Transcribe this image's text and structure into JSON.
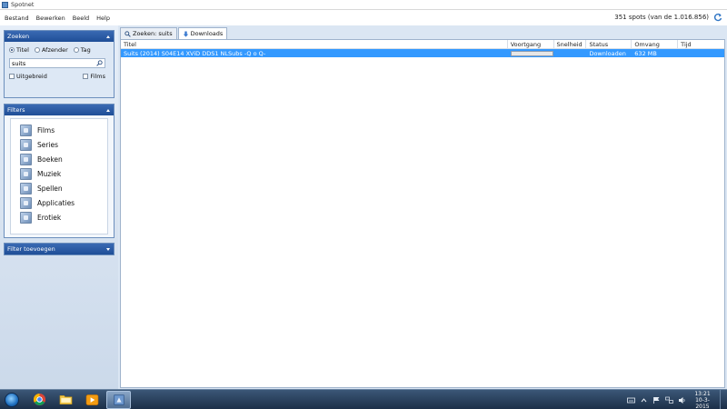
{
  "window": {
    "title": "Spotnet"
  },
  "menu": {
    "items": [
      "Bestand",
      "Bewerken",
      "Beeld",
      "Help"
    ],
    "spots_count": "351 spots (van de 1.016.856)"
  },
  "search_panel": {
    "title": "Zoeken",
    "radio_options": [
      "Titel",
      "Afzender",
      "Tag"
    ],
    "selected_option": "Titel",
    "search_value": "suits",
    "checkbox_uitgebreid": "Uitgebreid",
    "checkbox_films": "Films"
  },
  "filters_panel": {
    "title": "Filters",
    "items": [
      "Films",
      "Series",
      "Boeken",
      "Muziek",
      "Spellen",
      "Applicaties",
      "Erotiek"
    ]
  },
  "filter_add_panel": {
    "title": "Filter toevoegen"
  },
  "tabs": [
    {
      "label": "Zoeken: suits",
      "active": false
    },
    {
      "label": "Downloads",
      "active": true
    }
  ],
  "downloads_table": {
    "columns": [
      "Titel",
      "Voortgang",
      "Snelheid",
      "Status",
      "Omvang",
      "Tijd"
    ],
    "rows": [
      {
        "titel": "Suits (2014) S04E14 XViD DDS1 NLSubs -Q o Q-",
        "progress": 0,
        "snelheid": "",
        "status": "Downloaden",
        "omvang": "632 MB",
        "tijd": ""
      }
    ]
  },
  "taskbar": {
    "clock_time": "13:21",
    "clock_date": "10-3-2015"
  },
  "colors": {
    "accent": "#1f4e97",
    "selection": "#3399ff",
    "taskbar": "#1c2f48"
  }
}
